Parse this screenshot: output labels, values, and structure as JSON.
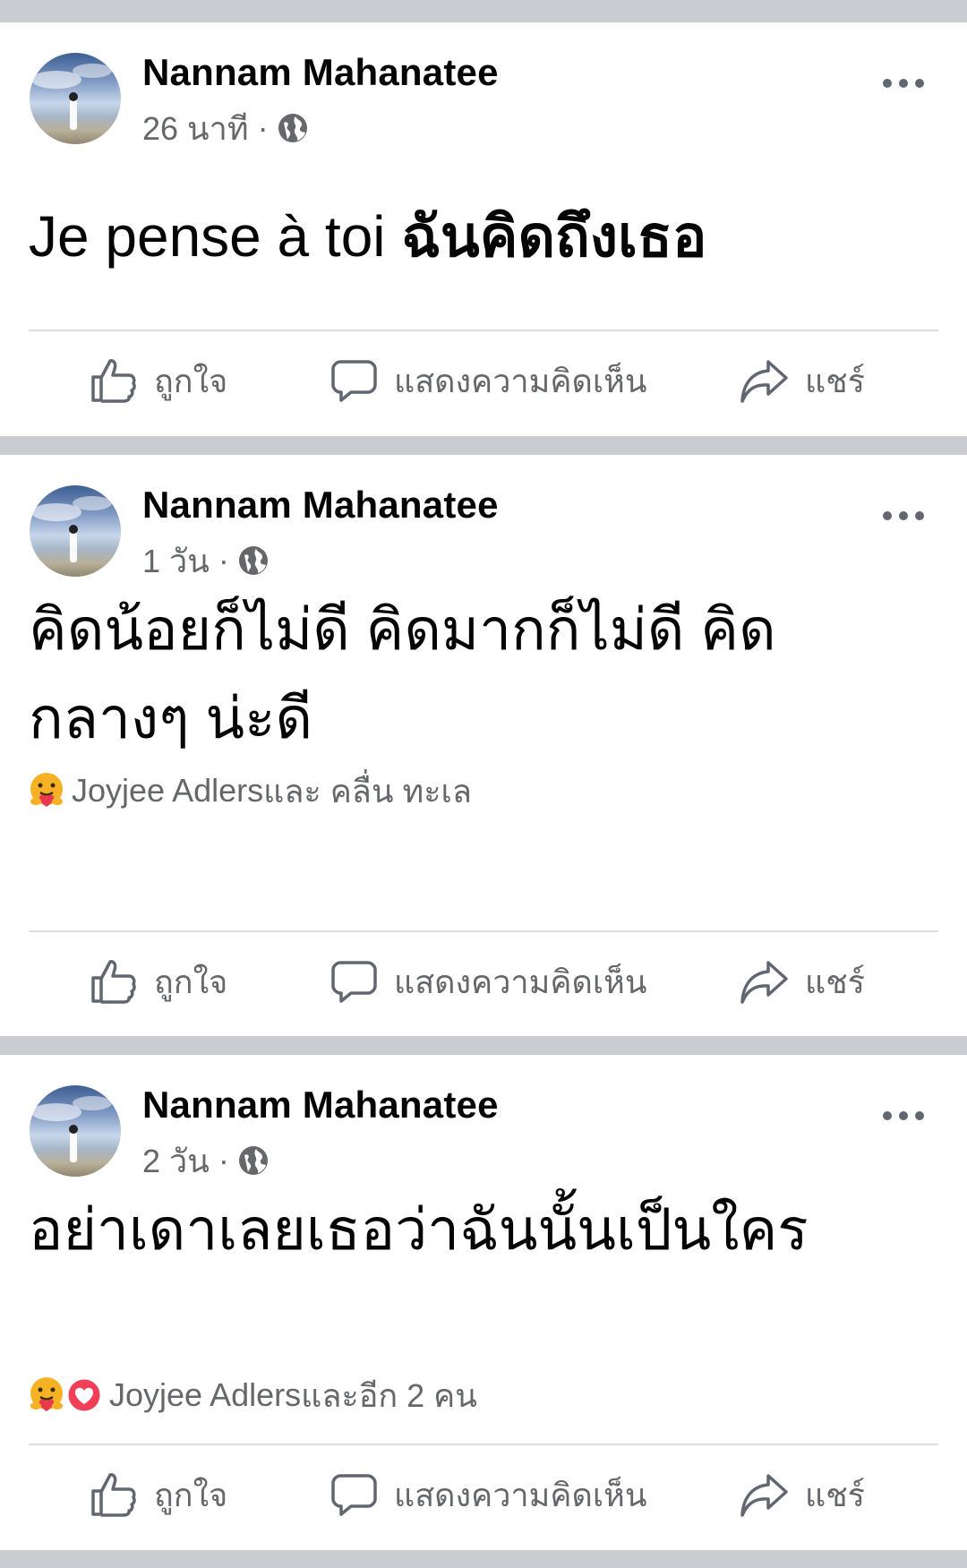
{
  "posts": [
    {
      "author": "Nannam Mahanatee",
      "time": "26 นาที",
      "separator": "·",
      "text_plain": "Je pense à toi ",
      "text_bold": "ฉันคิดถึงเธอ",
      "reactions": null,
      "actions": {
        "like": "ถูกใจ",
        "comment": "แสดงความคิดเห็น",
        "share": "แชร์"
      }
    },
    {
      "author": "Nannam Mahanatee",
      "time": "1 วัน",
      "separator": "·",
      "text_line1": "คิดน้อยก็ไม่ดี คิดมากก็ไม่ดี คิด",
      "text_line2": "กลางๆ น่ะดี",
      "reactions": {
        "names": "Joyjee Adlers",
        "rest": " และ คลื่น ทะเล",
        "icons": [
          "care-emoji"
        ]
      },
      "actions": {
        "like": "ถูกใจ",
        "comment": "แสดงความคิดเห็น",
        "share": "แชร์"
      }
    },
    {
      "author": "Nannam Mahanatee",
      "time": "2 วัน",
      "separator": "·",
      "text_line1": "อย่าเดาเลยเธอว่าฉันนั้นเป็นใคร",
      "reactions": {
        "names": "Joyjee Adlers",
        "rest": " และอีก 2 คน",
        "icons": [
          "care-emoji",
          "love-heart"
        ]
      },
      "actions": {
        "like": "ถูกใจ",
        "comment": "แสดงความคิดเห็น",
        "share": "แชร์"
      }
    }
  ],
  "colors": {
    "background": "#c9ccd1",
    "card": "#ffffff",
    "primary_text": "#050505",
    "secondary_text": "#65676b",
    "divider": "#dadde1"
  }
}
